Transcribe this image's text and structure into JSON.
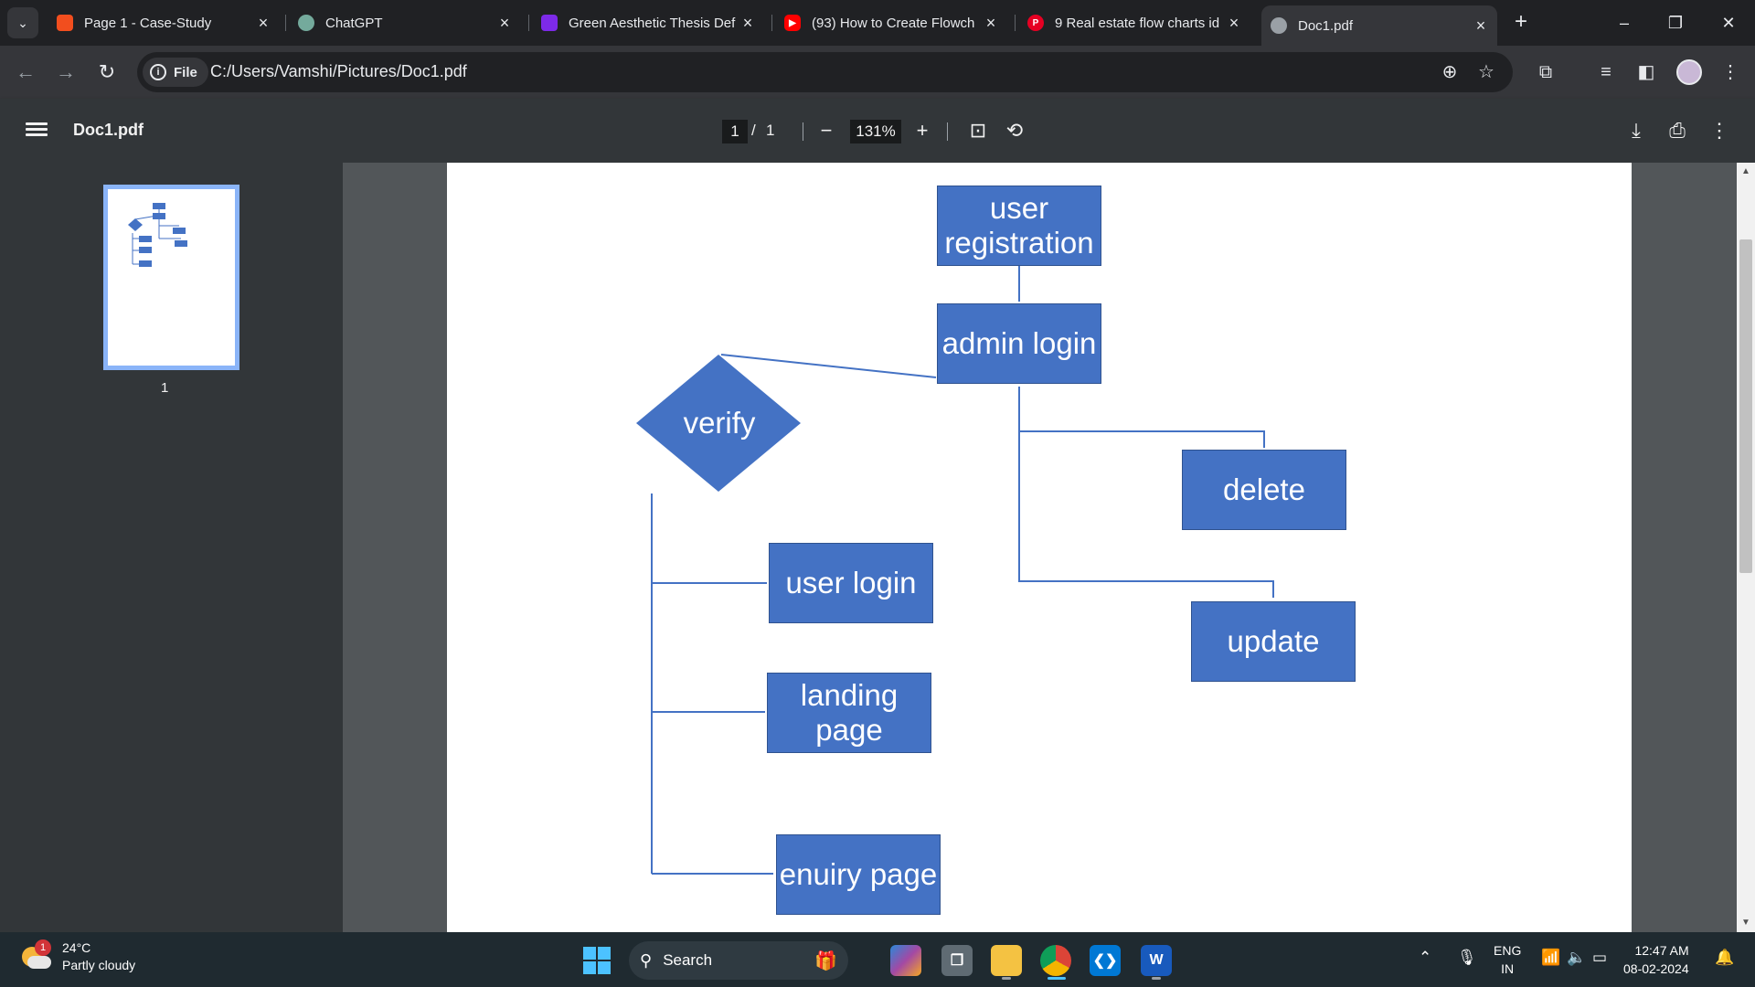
{
  "browser": {
    "tabs": [
      {
        "title": "Page 1 - Case-Study",
        "favicon": "figma-icon",
        "color": "#f24e1e",
        "active": false
      },
      {
        "title": "ChatGPT",
        "favicon": "chatgpt-icon",
        "color": "#74aa9c",
        "active": false
      },
      {
        "title": "Green Aesthetic Thesis Def",
        "favicon": "canva-icon",
        "color": "#7d2ae8",
        "active": false
      },
      {
        "title": "(93) How to Create Flowch",
        "favicon": "youtube-icon",
        "color": "#ff0000",
        "active": false
      },
      {
        "title": "9 Real estate flow charts id",
        "favicon": "pinterest-icon",
        "color": "#e60023",
        "active": false
      },
      {
        "title": "Doc1.pdf",
        "favicon": "globe-icon",
        "color": "#9aa0a6",
        "active": true
      }
    ],
    "address": {
      "chip_label": "File",
      "url": "C:/Users/Vamshi/Pictures/Doc1.pdf"
    }
  },
  "pdf": {
    "title": "Doc1.pdf",
    "page_current": "1",
    "page_separator": "/",
    "page_total": "1",
    "zoom": "131%",
    "thumbnail_label": "1"
  },
  "flowchart": {
    "nodes": {
      "user_registration": "user registration",
      "admin_login": "admin login",
      "verify": "verify",
      "delete": "delete",
      "update": "update",
      "user_login": "user login",
      "landing_page": "landing page",
      "enquiry_page": "enuiry page"
    },
    "fill_color": "#4472c4",
    "line_color": "#4472c4"
  },
  "taskbar": {
    "weather_temp": "24°C",
    "weather_desc": "Partly cloudy",
    "weather_badge": "1",
    "search_label": "Search",
    "lang_line1": "ENG",
    "lang_line2": "IN",
    "time": "12:47 AM",
    "date": "08-02-2024"
  }
}
